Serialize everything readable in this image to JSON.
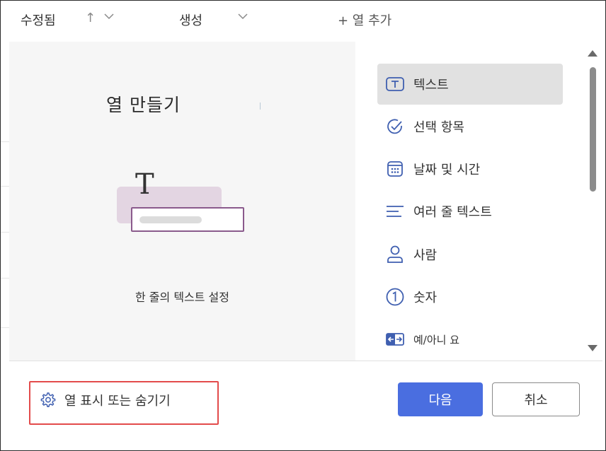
{
  "header": {
    "col_modified": "수정됨",
    "col_created": "생성",
    "add_column": "+ 열 추가"
  },
  "dialog": {
    "title": "열 만들기",
    "caption": "한 줄의 텍스트 설정",
    "types": [
      {
        "label": "텍스트",
        "icon": "text-box-icon",
        "selected": true
      },
      {
        "label": "선택 항목",
        "icon": "check-circle-icon",
        "selected": false
      },
      {
        "label": "날짜 및 시간",
        "icon": "calendar-icon",
        "selected": false
      },
      {
        "label": "여러 줄 텍스트",
        "icon": "multiline-text-icon",
        "selected": false
      },
      {
        "label": "사람",
        "icon": "person-icon",
        "selected": false
      },
      {
        "label": "숫자",
        "icon": "number-one-icon",
        "selected": false
      },
      {
        "label": "예/아니 요",
        "icon": "yes-no-toggle-icon",
        "selected": false
      }
    ],
    "footer_link": "열 표시 또는 숨기기",
    "next_button": "다음",
    "cancel_button": "취소"
  },
  "colors": {
    "accent": "#4a6ee0",
    "icon": "#3f5fb0",
    "highlight": "#e34b4b",
    "illustration_bg": "#e3d5e2",
    "illustration_border": "#8a5a8c"
  }
}
